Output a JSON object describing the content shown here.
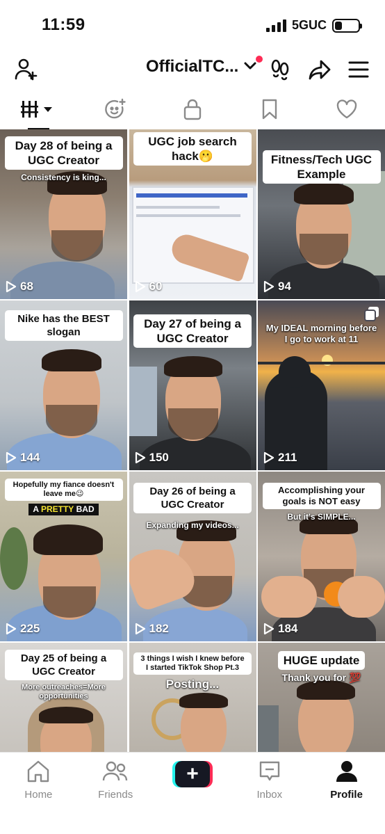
{
  "status_bar": {
    "time": "11:59",
    "network": "5GUC",
    "battery_level": 0.3
  },
  "header": {
    "username": "OfficialTC...",
    "icons": [
      "add-friend-icon",
      "chevron-down-icon",
      "footprints-icon",
      "share-icon",
      "menu-icon"
    ],
    "notification_dot_color": "#fe2c55"
  },
  "tabs": [
    {
      "name": "videos",
      "icon": "grid-icon",
      "active": true
    },
    {
      "name": "reposts",
      "icon": "repost-face-icon",
      "active": false
    },
    {
      "name": "private",
      "icon": "lock-icon",
      "active": false
    },
    {
      "name": "favorites",
      "icon": "bookmark-icon",
      "active": false
    },
    {
      "name": "liked",
      "icon": "heart-icon",
      "active": false
    }
  ],
  "videos": [
    {
      "caption": "Day 28 of being a UGC Creator",
      "subtitle": "Consistency is king...",
      "views": "68"
    },
    {
      "caption": "UGC job search hack🫢",
      "subtitle": "",
      "views": "60"
    },
    {
      "caption": "Fitness/Tech UGC Example",
      "subtitle": "",
      "views": "94"
    },
    {
      "caption": "Nike has the BEST slogan",
      "subtitle": "",
      "views": "144"
    },
    {
      "caption": "Day 27 of being a UGC Creator",
      "subtitle": "",
      "views": "150"
    },
    {
      "caption": "",
      "subtitle": "My IDEAL morning before I go to work at 11",
      "views": "211",
      "multi": true
    },
    {
      "caption": "Hopefully my fiance doesn't leave me😉",
      "subtitle_prefix": "A ",
      "subtitle_highlight": "PRETTY",
      "subtitle_suffix": " BAD",
      "views": "225"
    },
    {
      "caption": "Day 26 of being a UGC Creator",
      "subtitle": "Expanding my videos...",
      "views": "182"
    },
    {
      "caption": "Accomplishing your goals is NOT easy",
      "subtitle": "But it's SIMPLE...",
      "views": "184"
    },
    {
      "caption": "Day 25 of being a UGC Creator",
      "subtitle": "More outreaches=More opportunities",
      "views": ""
    },
    {
      "caption": "3 things I wish I knew before I started TikTok Shop Pt.3",
      "subtitle": "Posting...",
      "views": ""
    },
    {
      "caption": "HUGE update",
      "subtitle": "Thank you for 💯",
      "views": ""
    }
  ],
  "bottom_nav": {
    "home": "Home",
    "friends": "Friends",
    "create": "+",
    "inbox": "Inbox",
    "profile": "Profile"
  },
  "colors": {
    "accent_red": "#fe2c55",
    "accent_cyan": "#25f4ee",
    "dark": "#161823"
  }
}
